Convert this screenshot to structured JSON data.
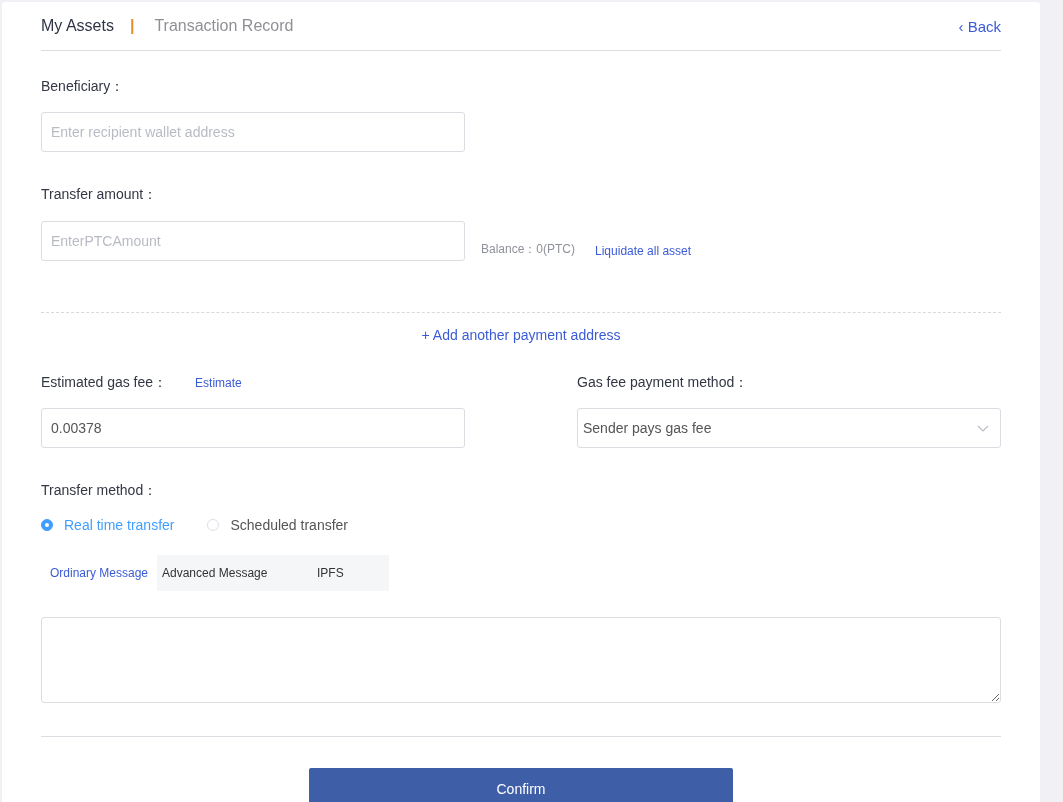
{
  "tabs": [
    {
      "label": "My Assets",
      "selected": true
    },
    {
      "label": "Transaction Record",
      "selected": false
    }
  ],
  "tab_separator": "|",
  "back_link": {
    "icon": "‹",
    "label": "Back"
  },
  "beneficiary": {
    "label": "Beneficiary：",
    "placeholder": "Enter recipient wallet address"
  },
  "transfer_amount": {
    "label": "Transfer amount：",
    "placeholder": "EnterPTCAmount",
    "balance": "Balance：0(PTC)",
    "liquidate_link": "Liquidate all asset"
  },
  "add_address_link": "+ Add another payment address",
  "gas_fee": {
    "label": "Estimated gas fee：",
    "estimate_link": "Estimate",
    "value": "0.00378"
  },
  "gas_payment": {
    "label": "Gas fee payment method：",
    "value": "Sender pays gas fee"
  },
  "transfer_method": {
    "label": "Transfer method：",
    "options": [
      {
        "label": "Real time transfer",
        "selected": true
      },
      {
        "label": "Scheduled transfer",
        "selected": false
      }
    ]
  },
  "message_tabs": [
    {
      "label": "Ordinary Message",
      "selected": true
    },
    {
      "label": "Advanced Message",
      "selected": false
    },
    {
      "label": "IPFS",
      "selected": false
    }
  ],
  "confirm_button": "Confirm"
}
